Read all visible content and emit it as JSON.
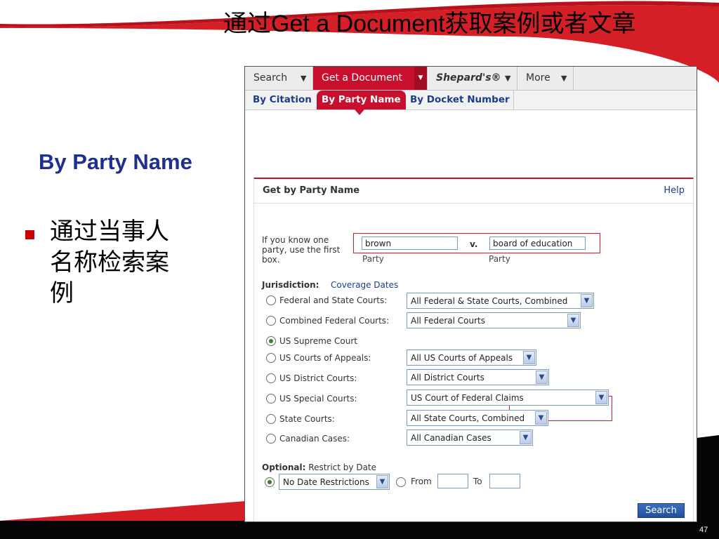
{
  "slide": {
    "title": "通过Get a Document获取案例或者文章",
    "heading": "By Party Name",
    "bullet": "通过当事人名称检索案例",
    "page_number": "47"
  },
  "colors": {
    "brand_red": "#c8102e",
    "link_blue": "#1a3d8f",
    "heading_blue": "#1f2f8f"
  },
  "app": {
    "top_nav": [
      {
        "label": "Search",
        "active": false
      },
      {
        "label": "Get a Document",
        "active": true
      },
      {
        "label": "Shepard's®",
        "active": false
      },
      {
        "label": "More",
        "active": false
      }
    ],
    "sub_nav": [
      {
        "label": "By Citation",
        "active": false
      },
      {
        "label": "By Party Name",
        "active": true
      },
      {
        "label": "By Docket Number",
        "active": false
      }
    ],
    "panel": {
      "title": "Get by Party Name",
      "help": "Help",
      "intro": "If you know one party, use the first box.",
      "party1": {
        "value": "brown",
        "label": "Party"
      },
      "versus": "v.",
      "party2": {
        "value": "board of education",
        "label": "Party"
      },
      "jurisdiction_label": "Jurisdiction:",
      "coverage_link": "Coverage Dates",
      "jurisdictions": [
        {
          "label": "Federal and State Courts:",
          "select": "All Federal & State Courts, Combined",
          "checked": false
        },
        {
          "label": "Combined Federal Courts:",
          "select": "All Federal Courts",
          "checked": false
        },
        {
          "label": "US Supreme Court",
          "select": null,
          "checked": true
        },
        {
          "label": "US Courts of Appeals:",
          "select": "All US Courts of Appeals",
          "checked": false
        },
        {
          "label": "US District Courts:",
          "select": "All District Courts",
          "checked": false
        },
        {
          "label": "US Special Courts:",
          "select": "US Court of Federal Claims",
          "checked": false
        },
        {
          "label": "State Courts:",
          "select": "All State Courts, Combined",
          "checked": false
        },
        {
          "label": "Canadian Cases:",
          "select": "All Canadian Cases",
          "checked": false
        }
      ],
      "optional": {
        "label": "Optional:",
        "text": "Restrict by Date",
        "date_select": "No Date Restrictions",
        "from_label": "From",
        "to_label": "To",
        "from_value": "",
        "to_value": ""
      },
      "search_button": "Search"
    }
  }
}
